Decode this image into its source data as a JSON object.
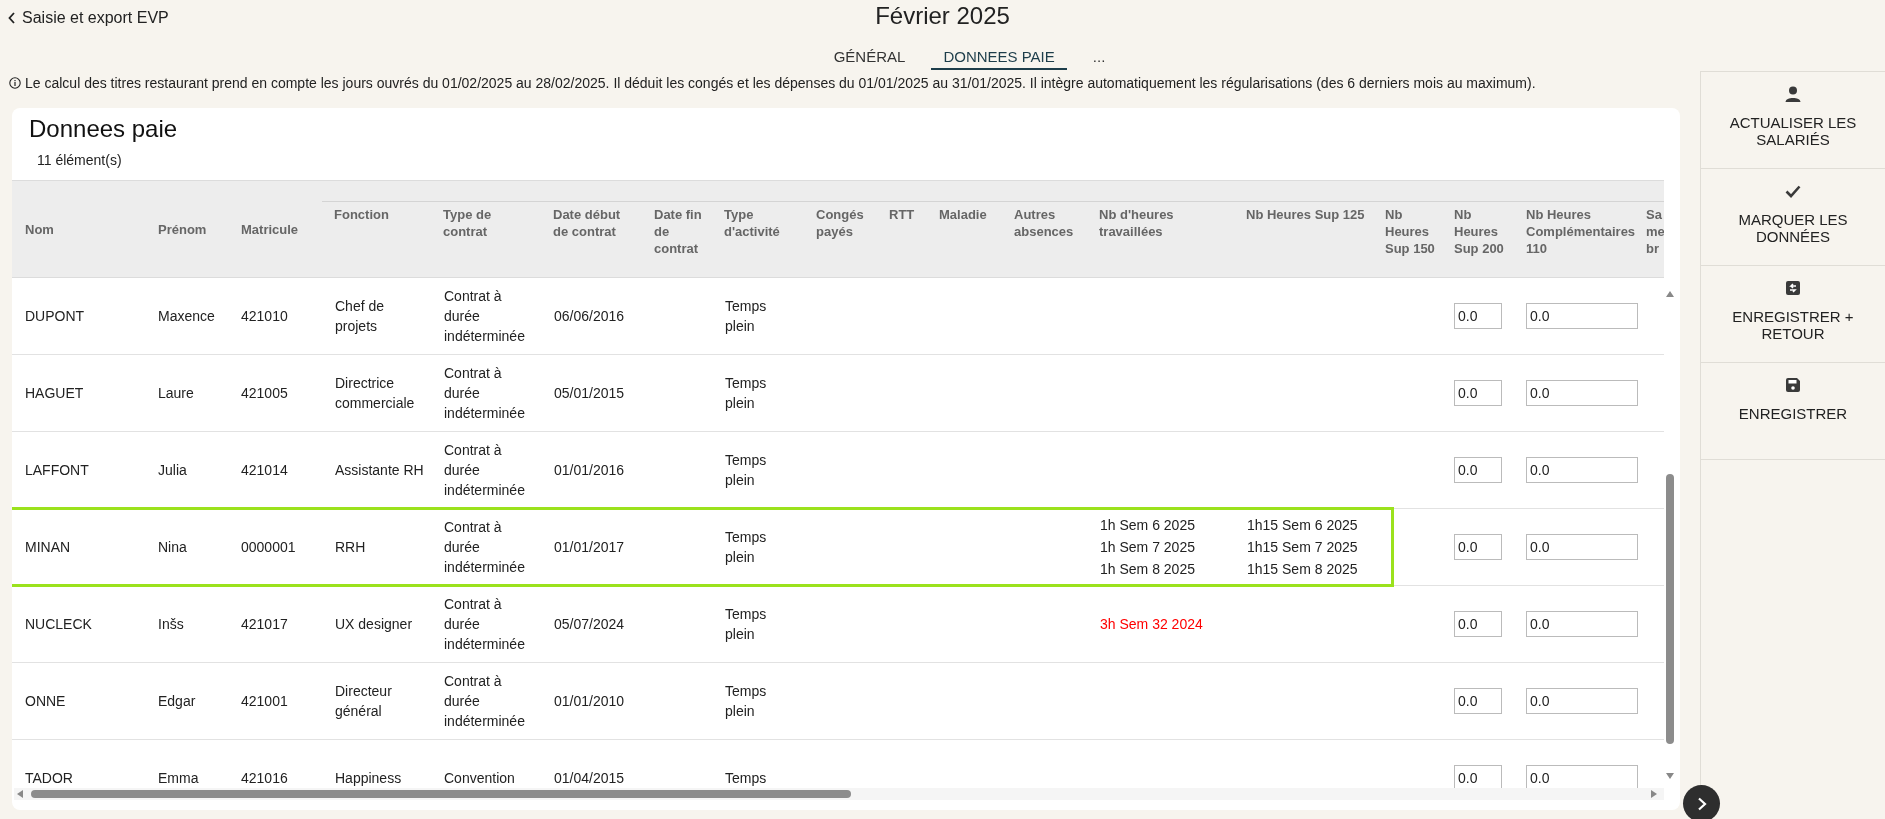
{
  "back_link": "Saisie et export EVP",
  "title": "Février 2025",
  "tabs": [
    {
      "label": "GÉNÉRAL",
      "selected": false
    },
    {
      "label": "DONNEES PAIE",
      "selected": true
    },
    {
      "label": "...",
      "selected": false
    }
  ],
  "info": "Le calcul des titres restaurant prend en compte les jours ouvrés du 01/02/2025 au 28/02/2025. Il déduit les congés et les dépenses du 01/01/2025 au 31/01/2025. Il intègre automatiquement les régularisations (des 6 derniers mois au maximum).",
  "panel": {
    "title": "Donnees paie",
    "count": "11 élément(s)"
  },
  "columns": [
    "Nom",
    "Prénom",
    "Matricule",
    "Fonction",
    "Type de contrat",
    "Date début de contrat",
    "Date fin de contrat",
    "Type d'activité",
    "Congés payés",
    "RTT",
    "Maladie",
    "Autres absences",
    "Nb d'heures travaillées",
    "Nb Heures Sup 125",
    "Nb Heures Sup 150",
    "Nb Heures Sup 200",
    "Nb Heures Complémentaires 110",
    "Sa me br"
  ],
  "rows": [
    {
      "nom": "DUPONT",
      "prenom": "Maxence",
      "matricule": "421010",
      "fonction": "Chef de projets",
      "type_contrat": "Contrat à durée indéterminée",
      "date_debut": "06/06/2016",
      "type_activite": "Temps plein",
      "heures_travaillees": [],
      "heures_sup_125": [],
      "sup_200": "0.0",
      "complementaires": "0.0",
      "selected": false
    },
    {
      "nom": "HAGUET",
      "prenom": "Laure",
      "matricule": "421005",
      "fonction": "Directrice commerciale",
      "type_contrat": "Contrat à durée indéterminée",
      "date_debut": "05/01/2015",
      "type_activite": "Temps plein",
      "heures_travaillees": [],
      "heures_sup_125": [],
      "sup_200": "0.0",
      "complementaires": "0.0",
      "selected": false
    },
    {
      "nom": "LAFFONT",
      "prenom": "Julia",
      "matricule": "421014",
      "fonction": "Assistante RH",
      "type_contrat": "Contrat à durée indéterminée",
      "date_debut": "01/01/2016",
      "type_activite": "Temps plein",
      "heures_travaillees": [],
      "heures_sup_125": [],
      "sup_200": "0.0",
      "complementaires": "0.0",
      "selected": false
    },
    {
      "nom": "MINAN",
      "prenom": "Nina",
      "matricule": "0000001",
      "fonction": "RRH",
      "type_contrat": "Contrat à durée indéterminée",
      "date_debut": "01/01/2017",
      "type_activite": "Temps plein",
      "heures_travaillees": [
        {
          "text": "1h Sem 6 2025",
          "color": "#222222"
        },
        {
          "text": "1h Sem 7 2025",
          "color": "#222222"
        },
        {
          "text": "1h Sem 8 2025",
          "color": "#222222"
        }
      ],
      "heures_sup_125": [
        "1h15 Sem 6 2025",
        "1h15 Sem 7 2025",
        "1h15 Sem 8 2025"
      ],
      "sup_200": "0.0",
      "complementaires": "0.0",
      "selected": true
    },
    {
      "nom": "NUCLECK",
      "prenom": "Inšs",
      "matricule": "421017",
      "fonction": "UX designer",
      "type_contrat": "Contrat à durée indéterminée",
      "date_debut": "05/07/2024",
      "type_activite": "Temps plein",
      "heures_travaillees": [
        {
          "text": "3h Sem 32 2024",
          "color": "#ff0000"
        }
      ],
      "heures_sup_125": [],
      "sup_200": "0.0",
      "complementaires": "0.0",
      "selected": false
    },
    {
      "nom": "ONNE",
      "prenom": "Edgar",
      "matricule": "421001",
      "fonction": "Directeur général",
      "type_contrat": "Contrat à durée indéterminée",
      "date_debut": "01/01/2010",
      "type_activite": "Temps plein",
      "heures_travaillees": [],
      "heures_sup_125": [],
      "sup_200": "0.0",
      "complementaires": "0.0",
      "selected": false
    },
    {
      "nom": "TADOR",
      "prenom": "Emma",
      "matricule": "421016",
      "fonction": "Happiness",
      "type_contrat": "Convention",
      "date_debut": "01/04/2015",
      "type_activite": "Temps",
      "heures_travaillees": [],
      "heures_sup_125": [],
      "sup_200": "0.0",
      "complementaires": "0.0",
      "selected": false
    }
  ],
  "actions": [
    {
      "kind": "person",
      "label": "ACTUALISER LES SALARIÉS"
    },
    {
      "kind": "check",
      "label": "MARQUER LES DONNÉES"
    },
    {
      "kind": "save-return",
      "label": "ENREGISTRER + RETOUR"
    },
    {
      "kind": "save",
      "label": "ENREGISTRER"
    }
  ]
}
